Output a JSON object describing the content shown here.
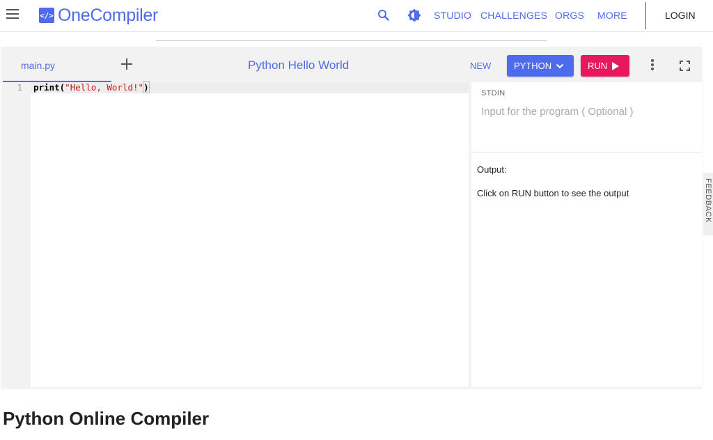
{
  "header": {
    "logo_mark": "</>",
    "logo_text": "OneCompiler",
    "nav": {
      "studio": "STUDIO",
      "challenges": "CHALLENGES",
      "orgs": "ORGS",
      "more": "MORE",
      "login": "LOGIN"
    },
    "icons": [
      "menu-icon",
      "search-icon",
      "theme-icon"
    ]
  },
  "editor": {
    "file_tab": "main.py",
    "title": "Python Hello World",
    "new_label": "NEW",
    "language_label": "PYTHON",
    "run_label": "RUN",
    "line_number": "1",
    "code": {
      "fn": "print",
      "open": "(",
      "string": "\"Hello, World!\"",
      "close": ")"
    }
  },
  "io": {
    "stdin_label": "STDIN",
    "stdin_placeholder": "Input for the program ( Optional )",
    "output_label": "Output:",
    "output_text": "Click on RUN button to see the output"
  },
  "feedback_label": "FEEDBACK",
  "page_heading": "Python Online Compiler",
  "colors": {
    "accent": "#4f6bed",
    "run": "#e8185d",
    "string": "#c41a16"
  }
}
